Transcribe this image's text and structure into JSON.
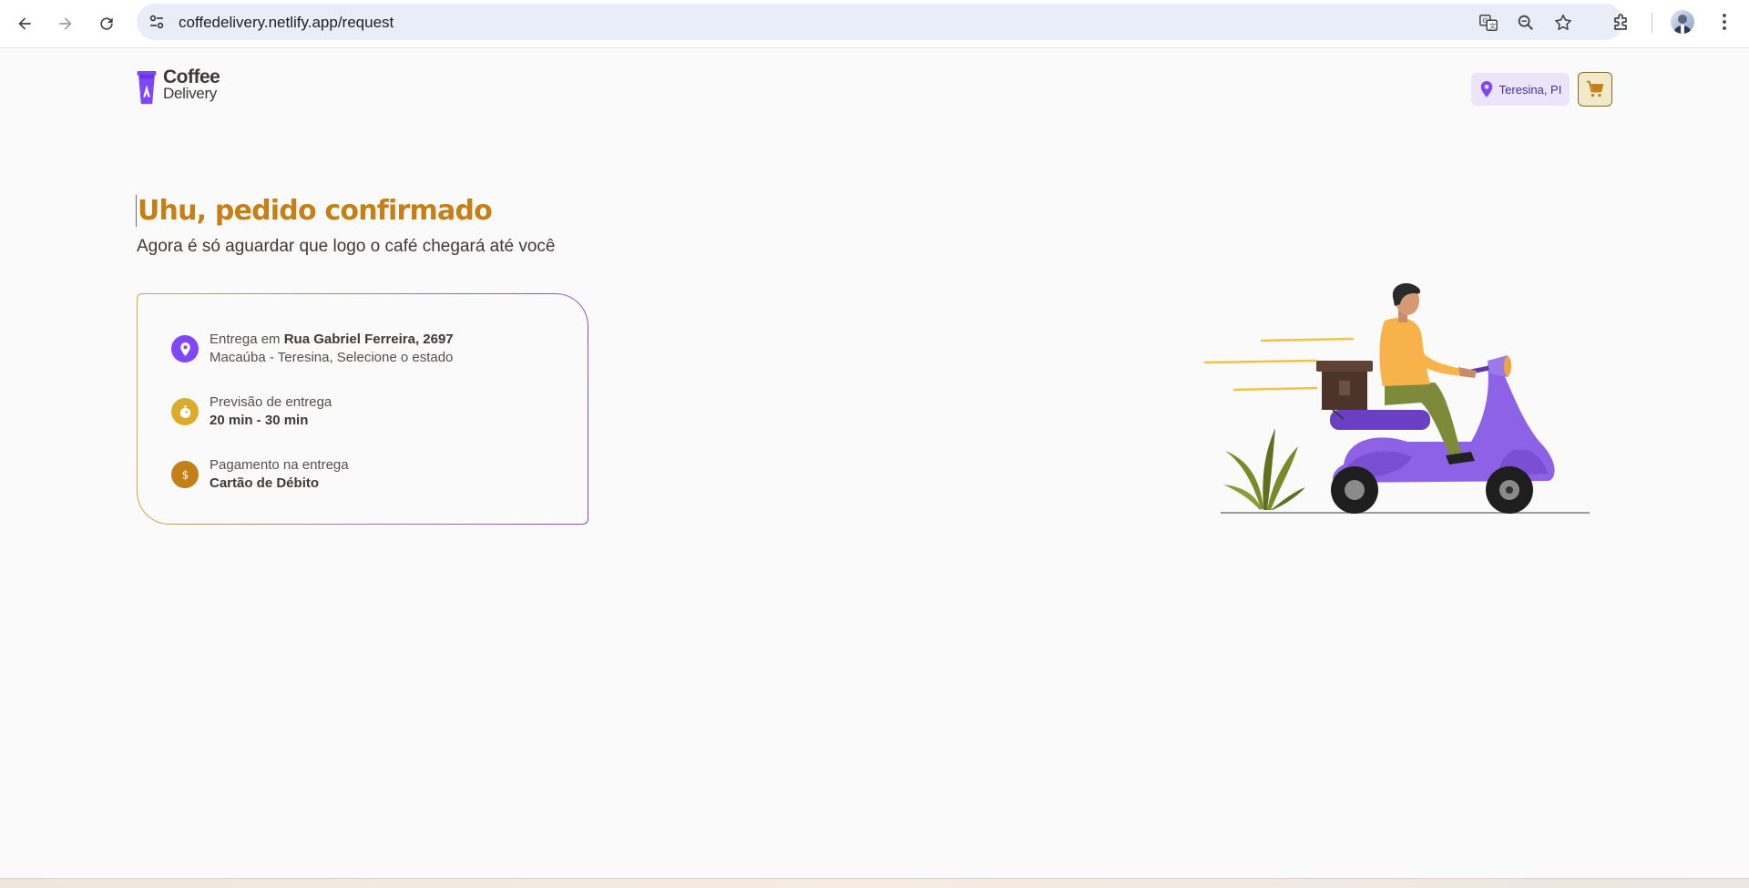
{
  "browser": {
    "url": "coffedelivery.netlify.app/request",
    "icons": [
      "back-arrow-icon",
      "forward-arrow-icon",
      "reload-icon",
      "site-info-icon",
      "translate-icon",
      "zoom-icon",
      "bookmark-star-icon",
      "extensions-icon",
      "profile-avatar",
      "more-menu-icon"
    ]
  },
  "header": {
    "logo_line1": "Coffee",
    "logo_line2": "Delivery",
    "location": "Teresina, PI"
  },
  "main": {
    "title": "Uhu, pedido confirmado",
    "subtitle": "Agora é só aguardar que logo o café chegará até você",
    "delivery": {
      "prefix": "Entrega em ",
      "street": "Rua Gabriel Ferreira, 2697",
      "district_line": "Macaúba - Teresina, Selecione o estado"
    },
    "eta": {
      "label": "Previsão de entrega",
      "value": "20 min - 30 min"
    },
    "payment": {
      "label": "Pagamento na entrega",
      "value": "Cartão de Débito"
    }
  },
  "colors": {
    "purple": "#8047f8",
    "yellow": "#dbac2c",
    "yellow_dark": "#c47f17",
    "base_text": "#403937"
  }
}
